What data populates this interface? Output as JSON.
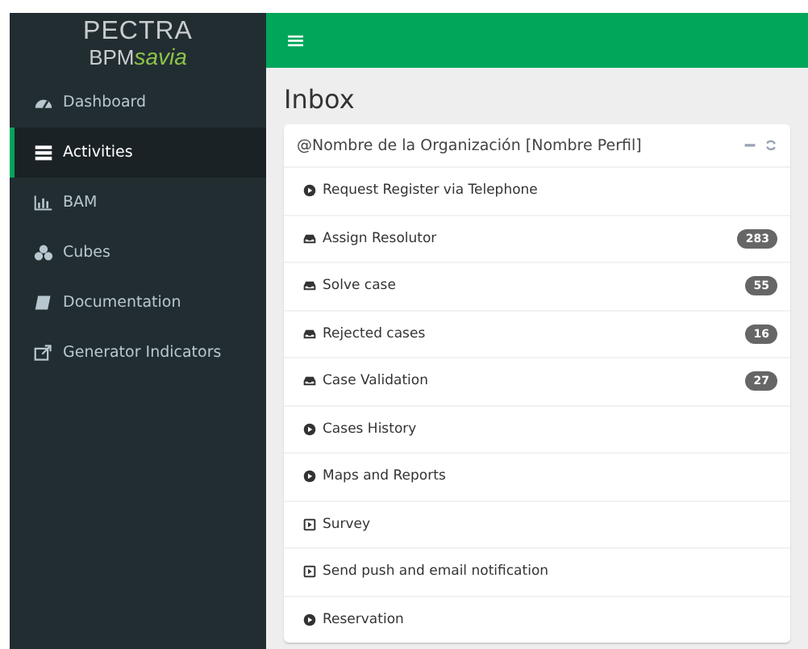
{
  "logo": {
    "line_1": "PECTRA",
    "line_2_a": "BPM",
    "line_2_b": "savia"
  },
  "topbar": {
    "menu_icon": "≡"
  },
  "sidebar": {
    "items": [
      {
        "label": "Dashboard",
        "kind": "dashboard",
        "selected": false
      },
      {
        "label": "Activities",
        "kind": "list",
        "selected": true
      },
      {
        "label": "BAM",
        "kind": "chart",
        "selected": false
      },
      {
        "label": "Cubes",
        "kind": "cubes",
        "selected": false
      },
      {
        "label": "Documentation",
        "kind": "book",
        "selected": false
      },
      {
        "label": "Generator Indicators",
        "kind": "external",
        "selected": false
      }
    ]
  },
  "page_title": "Inbox",
  "card": {
    "title": "@Nombre de la Organización [Nombre Perfil]",
    "items": [
      {
        "label": "Request Register via Telephone",
        "kind": "play"
      },
      {
        "label": "Assign Resolutor",
        "kind": "inbox",
        "count": "283"
      },
      {
        "label": "Solve case",
        "kind": "inbox",
        "count": "55"
      },
      {
        "label": "Rejected cases",
        "kind": "inbox",
        "count": "16"
      },
      {
        "label": "Case Validation",
        "kind": "inbox",
        "count": "27"
      },
      {
        "label": "Cases History",
        "kind": "play"
      },
      {
        "label": "Maps and Reports",
        "kind": "play"
      },
      {
        "label": "Survey",
        "kind": "square"
      },
      {
        "label": "Send push and email notification",
        "kind": "square"
      },
      {
        "label": "Reservation",
        "kind": "play"
      }
    ]
  }
}
